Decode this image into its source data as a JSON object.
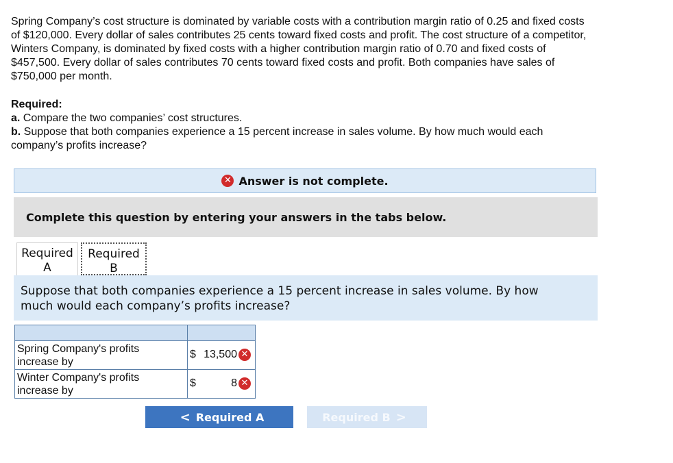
{
  "problem": {
    "line1": "Spring Company’s cost structure is dominated by variable costs with a contribution margin ratio of 0.25 and fixed costs",
    "line2": "of $120,000. Every dollar of sales contributes 25 cents toward fixed costs and profit. The cost structure of a competitor,",
    "line3": "Winters Company, is dominated by fixed costs with a higher contribution margin ratio of 0.70 and fixed costs of",
    "line4": "$457,500. Every dollar of sales contributes 70 cents toward fixed costs and profit. Both companies have sales of",
    "line5": "$750,000 per month."
  },
  "required": {
    "heading": "Required:",
    "a_label": "a.",
    "a_text": " Compare the two companies’ cost structures.",
    "b_label": "b.",
    "b_text_1": " Suppose that both companies experience a 15 percent increase in sales volume. By how much would each",
    "b_text_2": "company’s profits increase?"
  },
  "status": {
    "icon": "x-circle-icon",
    "icon_glyph": "✕",
    "text": "Answer is not complete.",
    "color": "#d12b2b"
  },
  "instruction": "Complete this question by entering your answers in the tabs below.",
  "tabs": [
    {
      "line1": "Required",
      "line2": "A"
    },
    {
      "line1": "Required",
      "line2": "B"
    }
  ],
  "panel_text_1": "Suppose that both companies experience a 15 percent increase in sales volume. By how",
  "panel_text_2": "much would each company’s profits increase?",
  "table": {
    "rows": [
      {
        "label_1": "Spring Company's profits",
        "label_2": "increase by",
        "currency": "$",
        "value": "13,500",
        "status_glyph": "✕"
      },
      {
        "label_1": "Winter Company's profits",
        "label_2": "increase by",
        "currency": "$",
        "value": "8",
        "status_glyph": "✕"
      }
    ]
  },
  "nav": {
    "prev_label": "Required A",
    "next_label": "Required B",
    "prev_chevron": "<",
    "next_chevron": ">"
  }
}
